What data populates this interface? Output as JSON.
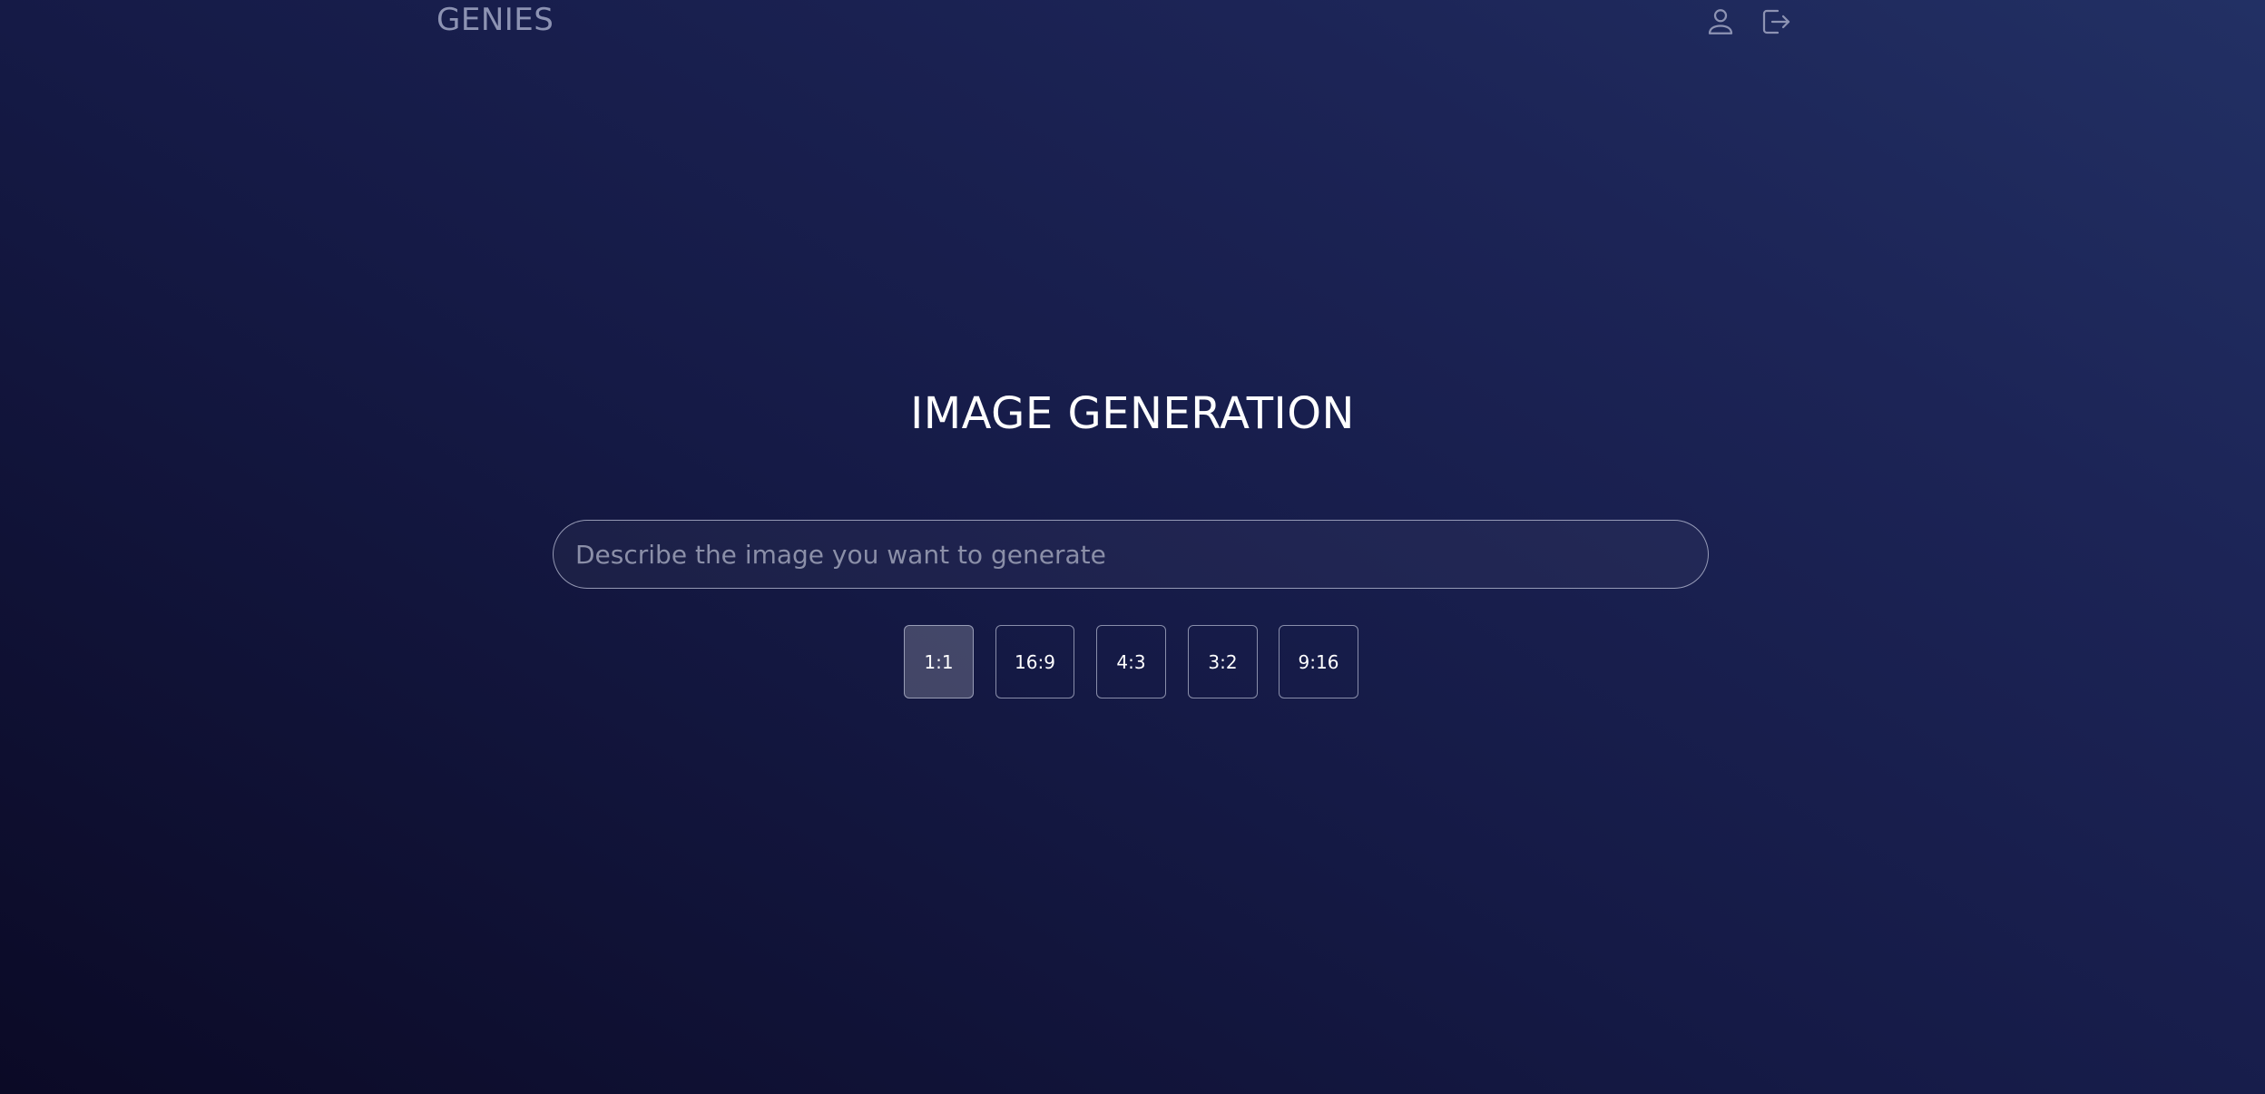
{
  "header": {
    "brand": "GENIES",
    "icons": [
      "user-icon",
      "logout-icon"
    ]
  },
  "main": {
    "title": "IMAGE GENERATION",
    "prompt": {
      "placeholder": "Describe the image you want to generate",
      "value": ""
    },
    "aspect_ratios": [
      {
        "label": "1:1",
        "selected": true
      },
      {
        "label": "16:9",
        "selected": false
      },
      {
        "label": "4:3",
        "selected": false
      },
      {
        "label": "3:2",
        "selected": false
      },
      {
        "label": "9:16",
        "selected": false
      }
    ]
  },
  "colors": {
    "background_dark": "#0b0a26",
    "background_light": "#223064",
    "brand_text": "#8d93b3",
    "border": "#c8cce1"
  }
}
